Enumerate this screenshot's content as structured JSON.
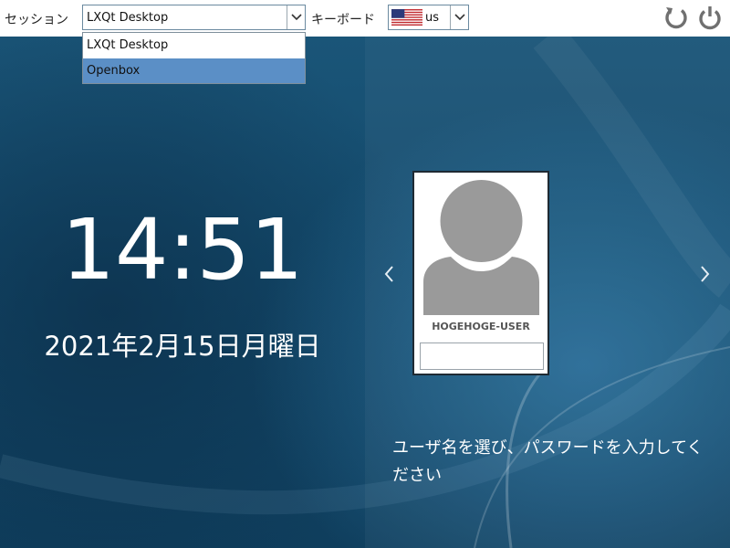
{
  "topbar": {
    "session_label": "セッション",
    "session_value": "LXQt Desktop",
    "keyboard_label": "キーボード",
    "keyboard_value": "us",
    "keyboard_flag": "us-flag-icon",
    "restart_icon": "restart-icon",
    "power_icon": "power-icon"
  },
  "session_dropdown": {
    "options": [
      {
        "label": "LXQt Desktop",
        "selected": false
      },
      {
        "label": "Openbox",
        "selected": true
      }
    ]
  },
  "clock": {
    "time": "14:51",
    "date": "2021年2月15日月曜日"
  },
  "user_card": {
    "username": "HOGEHOGE-USER",
    "password_value": "",
    "prev_icon": "chevron-left-icon",
    "next_icon": "chevron-right-icon"
  },
  "hint_text": "ユーザ名を選び、パスワードを入力してください",
  "colors": {
    "topbar_bg": "#ffffff",
    "selection": "#5b8fc6",
    "background": "#134a6c",
    "icon_gray": "#6f6f6f",
    "avatar_gray": "#9a9a9a"
  }
}
